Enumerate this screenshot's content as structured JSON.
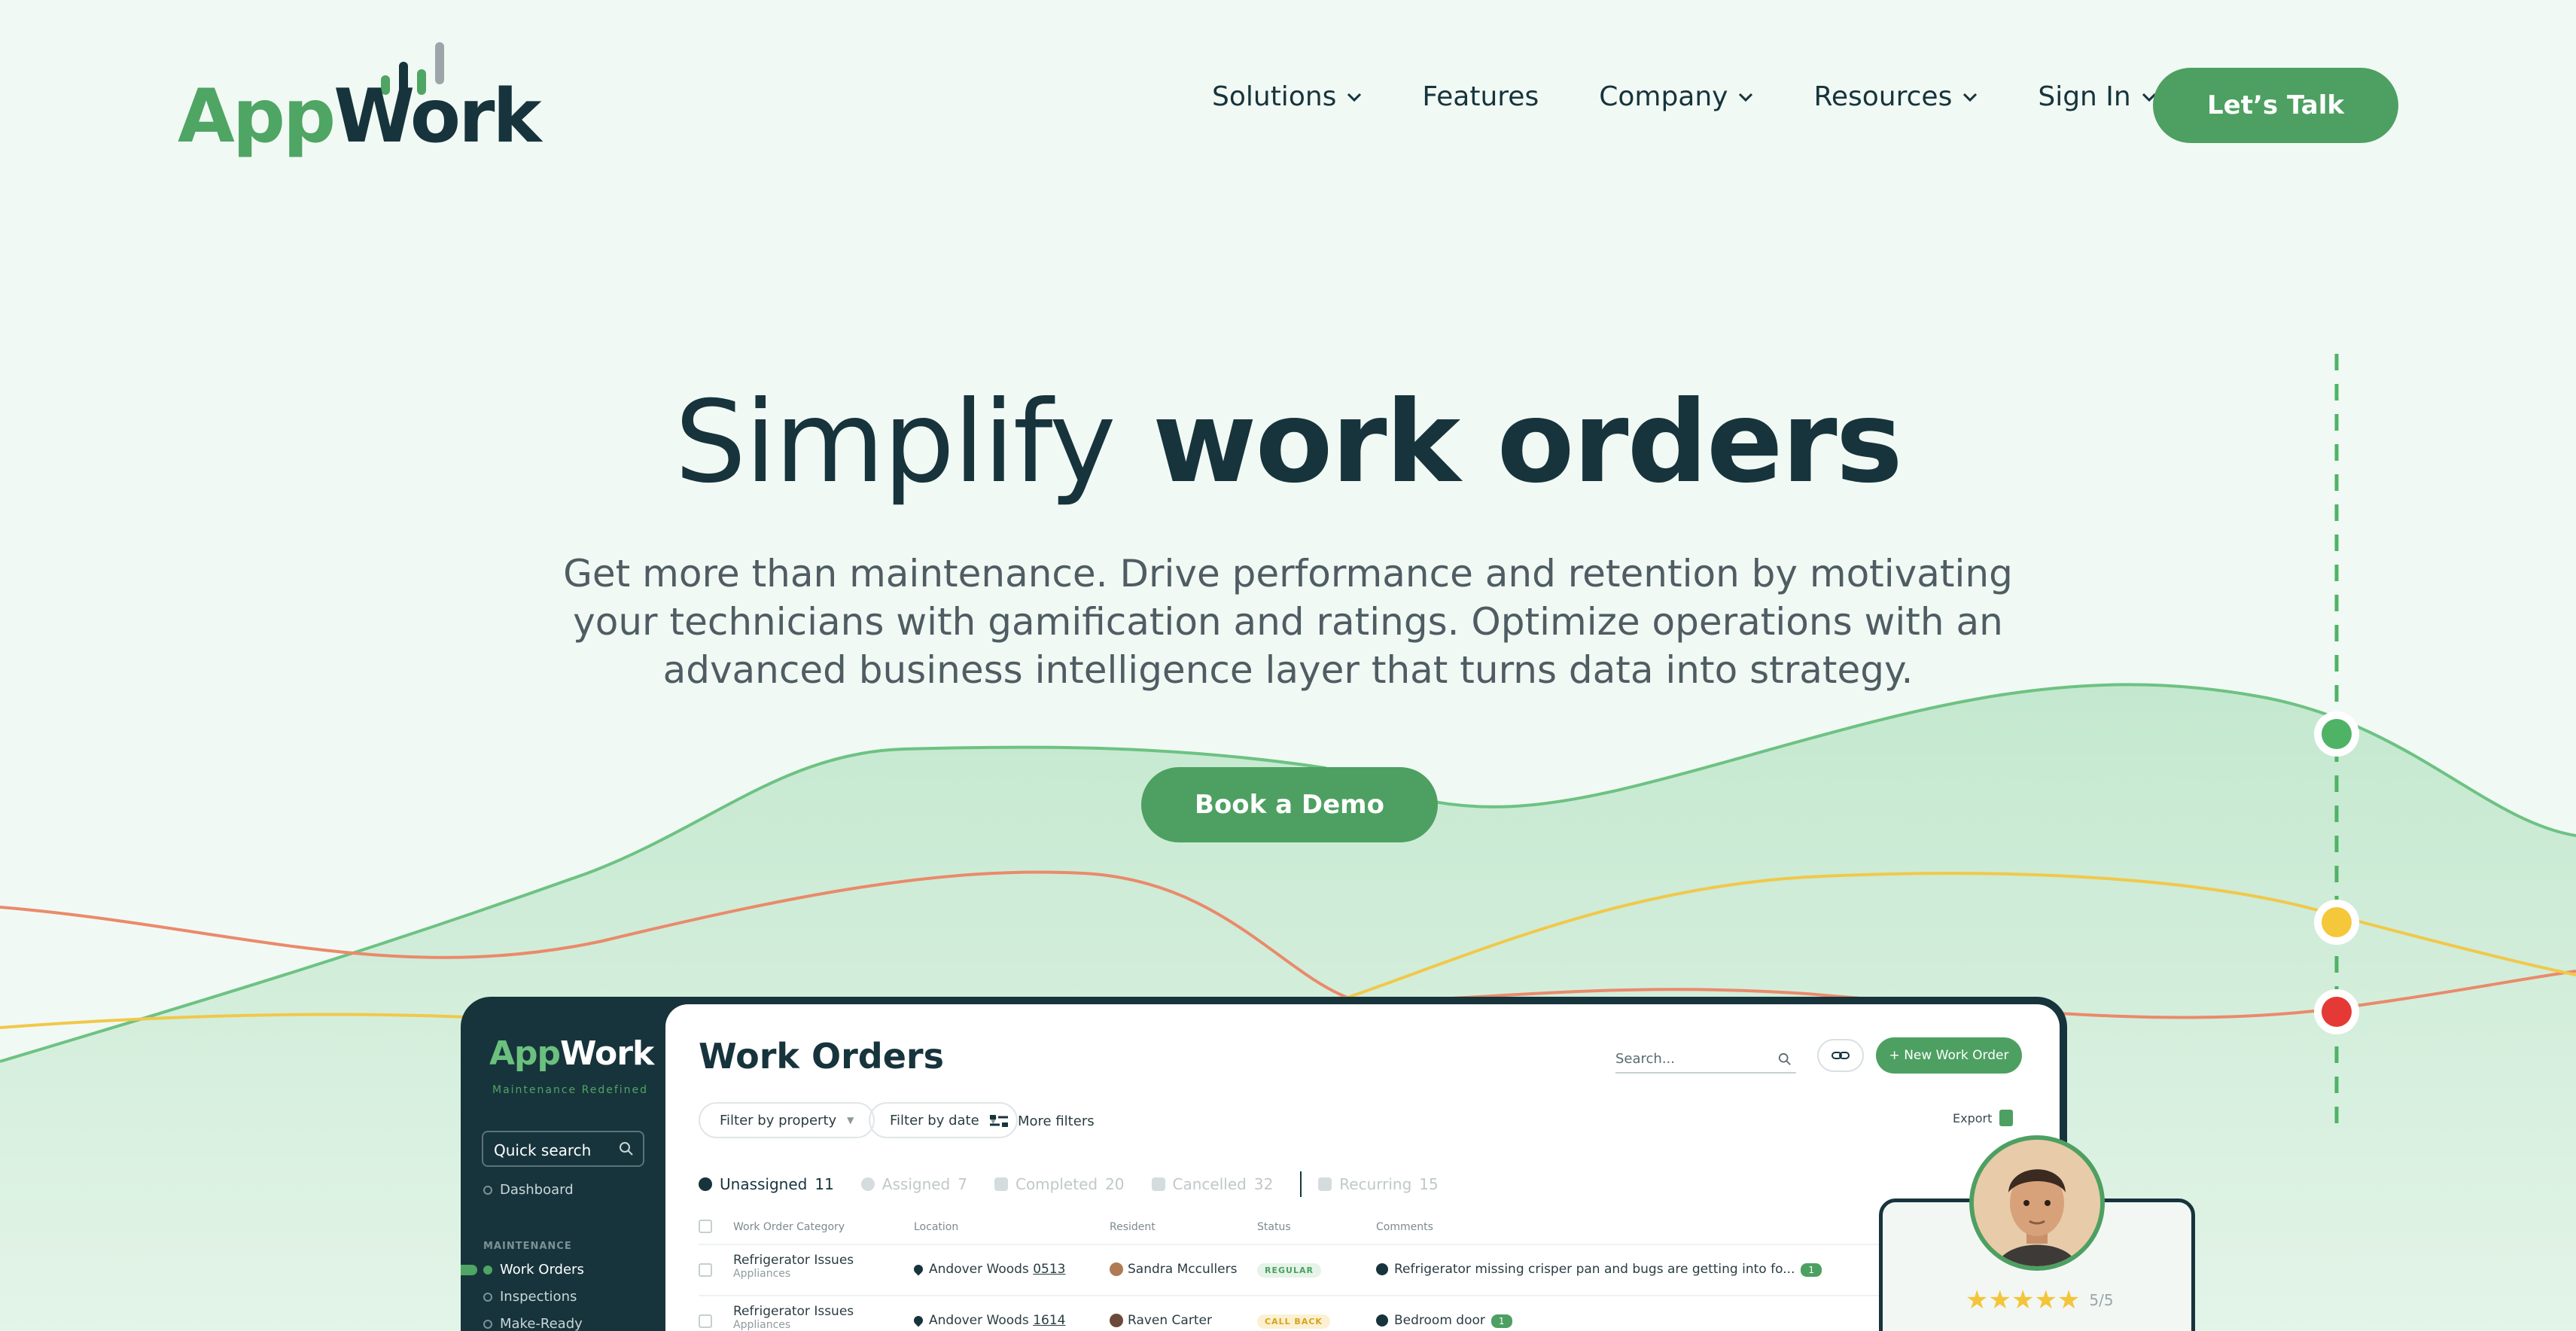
{
  "brand": {
    "logo_part1": "App",
    "logo_part2": "Work",
    "accent": "#4da061",
    "dark": "#17343c"
  },
  "nav": {
    "items": [
      {
        "label": "Solutions",
        "has_dropdown": true
      },
      {
        "label": "Features",
        "has_dropdown": false
      },
      {
        "label": "Company",
        "has_dropdown": true
      },
      {
        "label": "Resources",
        "has_dropdown": true
      },
      {
        "label": "Sign In",
        "has_dropdown": true
      }
    ],
    "cta": "Let’s Talk"
  },
  "hero": {
    "title_light": "Simplify",
    "title_bold": "work orders",
    "subtitle": "Get more than maintenance. Drive performance and retention by motivating your technicians with gamification and ratings. Optimize operations with an advanced business intelligence layer that turns data into strategy.",
    "cta": "Book a Demo",
    "marker_colors": [
      "#4fb366",
      "#f5c73a",
      "#e53935"
    ]
  },
  "dashboard": {
    "sidebar": {
      "logo_part1": "App",
      "logo_part2": "Work",
      "tagline": "Maintenance Redefined",
      "search_placeholder": "Quick search",
      "links": [
        "Dashboard"
      ],
      "section": "MAINTENANCE",
      "section_items": [
        "Work Orders",
        "Inspections",
        "Make-Ready"
      ],
      "active_item": "Work Orders"
    },
    "title": "Work Orders",
    "search_placeholder": "Search...",
    "new_button": "+ New Work Order",
    "filters": [
      "Filter by property",
      "Filter by date"
    ],
    "more_filters": "More filters",
    "export": "Export",
    "tabs": [
      {
        "label": "Unassigned",
        "count": "11",
        "active": true
      },
      {
        "label": "Assigned",
        "count": "7",
        "active": false
      },
      {
        "label": "Completed",
        "count": "20",
        "active": false
      },
      {
        "label": "Cancelled",
        "count": "32",
        "active": false
      },
      {
        "label": "Recurring",
        "count": "15",
        "active": false
      }
    ],
    "columns": [
      "Work Order Category",
      "Location",
      "Resident",
      "Status",
      "Comments"
    ],
    "rows": [
      {
        "category": "Refrigerator Issues",
        "subcategory": "Appliances",
        "location": "Andover Woods",
        "unit": "0513",
        "resident": "Sandra Mccullers",
        "status": "REGULAR",
        "comment": "Refrigerator missing crisper pan and bugs are getting into fo...",
        "comment_count": "1"
      },
      {
        "category": "Refrigerator Issues",
        "subcategory": "Appliances",
        "location": "Andover Woods",
        "unit": "1614",
        "resident": "Raven Carter",
        "status": "CALL BACK",
        "comment": "Bedroom door",
        "comment_count": "1"
      }
    ]
  },
  "rating": {
    "stars": "★★★★★",
    "value": 5,
    "max": 5,
    "score": "5/5"
  }
}
